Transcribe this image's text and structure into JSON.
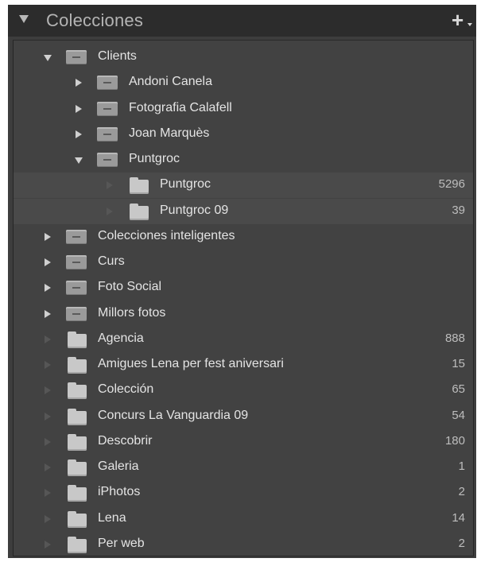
{
  "panel": {
    "title": "Colecciones",
    "add_symbol": "+"
  },
  "rows": [
    {
      "label": "Clients",
      "count": "",
      "type": "set",
      "state": "expanded",
      "depth": 0
    },
    {
      "label": "Andoni Canela",
      "count": "",
      "type": "set",
      "state": "collapsed",
      "depth": 1
    },
    {
      "label": "Fotografia Calafell",
      "count": "",
      "type": "set",
      "state": "collapsed",
      "depth": 1
    },
    {
      "label": "Joan Marquès",
      "count": "",
      "type": "set",
      "state": "collapsed",
      "depth": 1
    },
    {
      "label": "Puntgroc",
      "count": "",
      "type": "set",
      "state": "expanded",
      "depth": 1
    },
    {
      "label": "Puntgroc",
      "count": "5296",
      "type": "collection",
      "state": "none",
      "depth": 2
    },
    {
      "label": "Puntgroc 09",
      "count": "39",
      "type": "collection",
      "state": "none",
      "depth": 2
    },
    {
      "label": "Colecciones inteligentes",
      "count": "",
      "type": "set",
      "state": "collapsed",
      "depth": 0
    },
    {
      "label": "Curs",
      "count": "",
      "type": "set",
      "state": "collapsed",
      "depth": 0
    },
    {
      "label": "Foto Social",
      "count": "",
      "type": "set",
      "state": "collapsed",
      "depth": 0
    },
    {
      "label": "Millors fotos",
      "count": "",
      "type": "set",
      "state": "collapsed",
      "depth": 0
    },
    {
      "label": "Agencia",
      "count": "888",
      "type": "collection",
      "state": "none",
      "depth": 0
    },
    {
      "label": "Amigues Lena per fest aniversari",
      "count": "15",
      "type": "collection",
      "state": "none",
      "depth": 0
    },
    {
      "label": "Colección",
      "count": "65",
      "type": "collection",
      "state": "none",
      "depth": 0
    },
    {
      "label": "Concurs La Vanguardia 09",
      "count": "54",
      "type": "collection",
      "state": "none",
      "depth": 0
    },
    {
      "label": "Descobrir",
      "count": "180",
      "type": "collection",
      "state": "none",
      "depth": 0
    },
    {
      "label": "Galeria",
      "count": "1",
      "type": "collection",
      "state": "none",
      "depth": 0
    },
    {
      "label": "iPhotos",
      "count": "2",
      "type": "collection",
      "state": "none",
      "depth": 0
    },
    {
      "label": "Lena",
      "count": "14",
      "type": "collection",
      "state": "none",
      "depth": 0
    },
    {
      "label": "Per web",
      "count": "2",
      "type": "collection",
      "state": "none",
      "depth": 0
    }
  ]
}
